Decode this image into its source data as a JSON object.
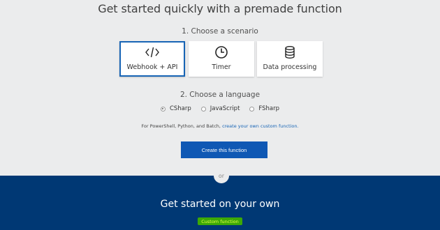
{
  "header": {
    "title": "Get started quickly with a premade function",
    "step1": "1. Choose a scenario"
  },
  "scenarios": [
    {
      "label": "Webhook + API",
      "icon": "code-icon",
      "selected": true
    },
    {
      "label": "Timer",
      "icon": "clock-icon",
      "selected": false
    },
    {
      "label": "Data processing",
      "icon": "database-icon",
      "selected": false
    }
  ],
  "language": {
    "step2": "2. Choose a language",
    "options": [
      {
        "label": "CSharp",
        "selected": true
      },
      {
        "label": "JavaScript",
        "selected": false
      },
      {
        "label": "FSharp",
        "selected": false
      }
    ]
  },
  "note": {
    "text": "For PowerShell, Python, and Batch,",
    "link": "create your own custom function."
  },
  "create_button": "Create this function",
  "divider": "or",
  "own": {
    "title": "Get started on your own",
    "custom_button": "Custom function"
  },
  "colors": {
    "accent": "#1764b5",
    "bottom_bg": "#003874",
    "custom_button_bg": "#3ca806"
  }
}
